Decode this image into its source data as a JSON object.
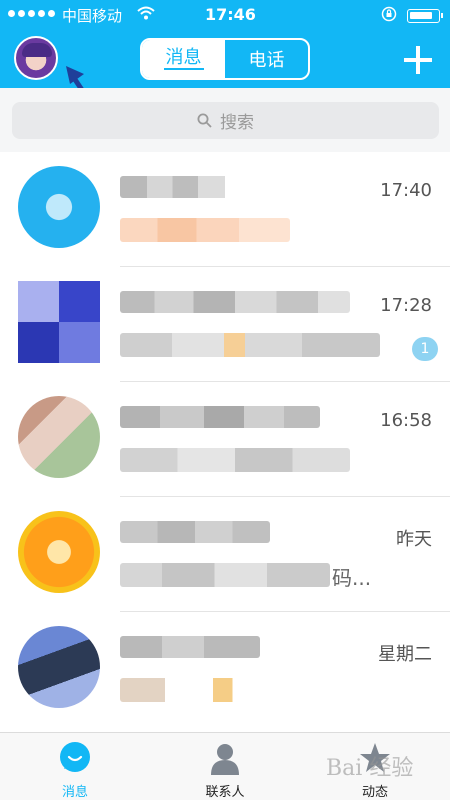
{
  "status_bar": {
    "carrier": "中国移动",
    "time": "17:46",
    "battery_level": 0.85
  },
  "header": {
    "tabs": [
      {
        "label": "消息",
        "active": true
      },
      {
        "label": "电话",
        "active": false
      }
    ],
    "add_icon": "plus-icon",
    "avatar_icon": "profile-avatar"
  },
  "search": {
    "placeholder": "搜索",
    "icon": "search-icon"
  },
  "conversations": [
    {
      "time": "17:40",
      "unread": null,
      "tail": ""
    },
    {
      "time": "17:28",
      "unread": "1",
      "tail": ""
    },
    {
      "time": "16:58",
      "unread": null,
      "tail": ""
    },
    {
      "time": "昨天",
      "unread": null,
      "tail": "码..."
    },
    {
      "time": "星期二",
      "unread": null,
      "tail": ""
    }
  ],
  "tabbar": {
    "items": [
      {
        "label": "消息",
        "icon": "message-bubble-icon",
        "active": true
      },
      {
        "label": "联系人",
        "icon": "contacts-person-icon",
        "active": false
      },
      {
        "label": "动态",
        "icon": "star-icon",
        "active": false
      }
    ]
  },
  "watermark": "Bai 经验",
  "colors": {
    "accent": "#12b7f5"
  }
}
